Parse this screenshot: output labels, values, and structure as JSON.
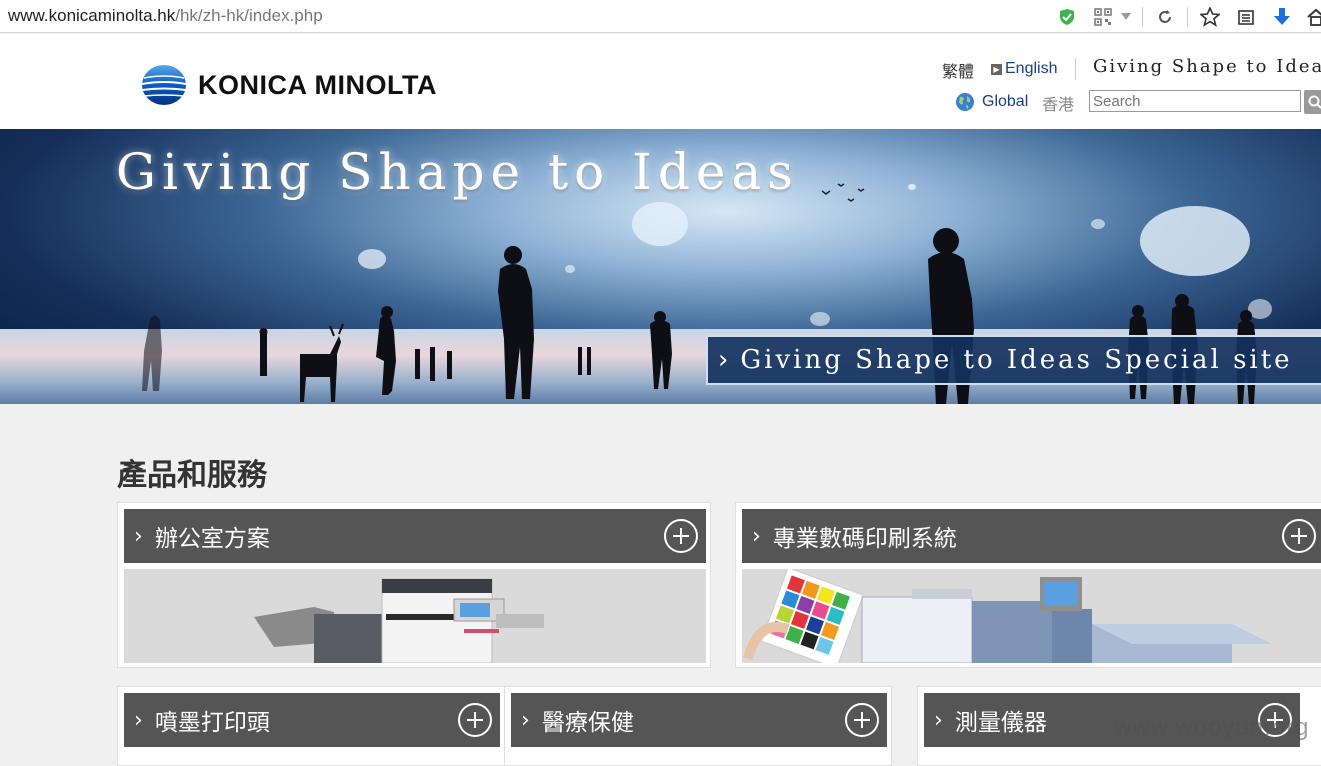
{
  "browser": {
    "url_domain": "www.konicaminolta.hk",
    "url_path": "/hk/zh-hk/index.php"
  },
  "header": {
    "logo_text": "KONICA MINOLTA",
    "lang_traditional": "繁體",
    "lang_english": "English",
    "tagline": "Giving Shape to Idea",
    "global_label": "Global",
    "region_label": "香港",
    "search_placeholder": "Search"
  },
  "hero": {
    "title": "Giving Shape to Ideas",
    "special_link": "Giving Shape to Ideas Special site"
  },
  "products": {
    "title": "產品和服務",
    "items": [
      {
        "label": "辦公室方案"
      },
      {
        "label": "專業數碼印刷系統"
      },
      {
        "label": "噴墨打印頭"
      },
      {
        "label": "醫療保健"
      },
      {
        "label": "測量儀器"
      }
    ]
  },
  "watermark": "www.wooyun.org",
  "colors": {
    "card_header": "#555555",
    "link_blue": "#1b3f86",
    "hero_dark": "#12325f"
  }
}
